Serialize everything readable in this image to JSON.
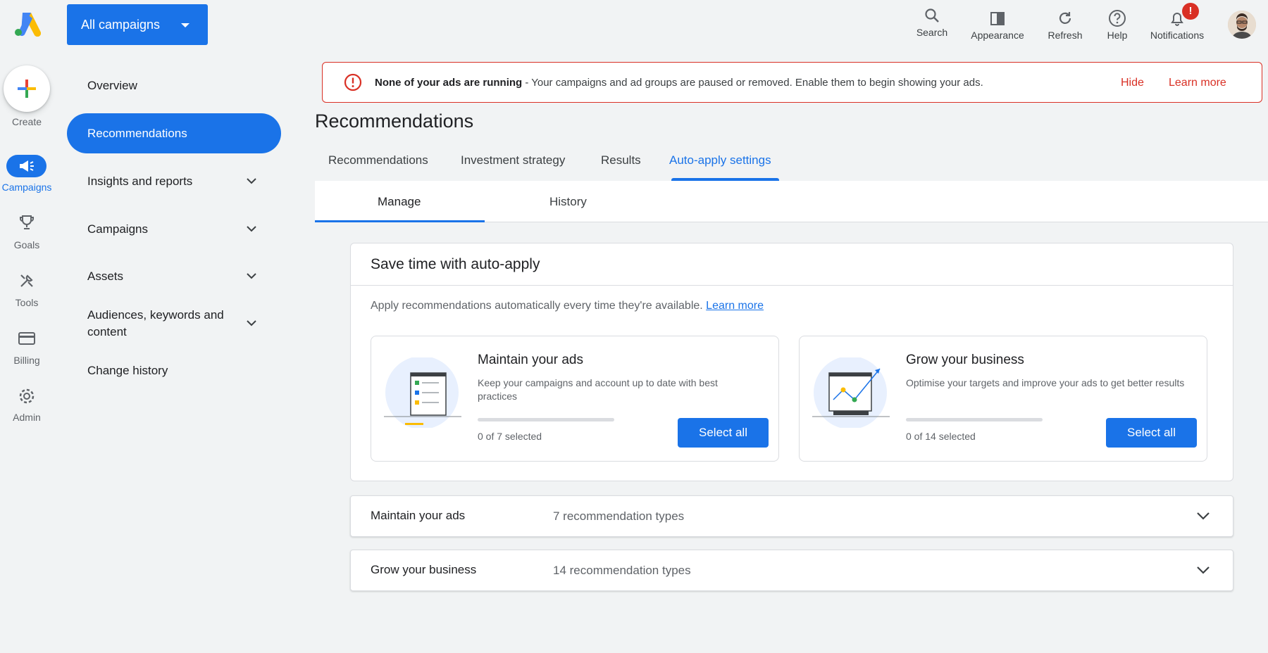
{
  "rail": {
    "create_label": "Create",
    "items": [
      {
        "label": "Campaigns",
        "icon": "campaigns-icon",
        "active": true
      },
      {
        "label": "Goals",
        "icon": "trophy-icon",
        "active": false
      },
      {
        "label": "Tools",
        "icon": "tools-icon",
        "active": false
      },
      {
        "label": "Billing",
        "icon": "credit-card-icon",
        "active": false
      },
      {
        "label": "Admin",
        "icon": "gear-icon",
        "active": false
      }
    ]
  },
  "header": {
    "campaign_selector": "All campaigns",
    "actions": [
      {
        "label": "Search",
        "icon": "search-icon"
      },
      {
        "label": "Appearance",
        "icon": "appearance-icon"
      },
      {
        "label": "Refresh",
        "icon": "refresh-icon"
      },
      {
        "label": "Help",
        "icon": "help-icon"
      },
      {
        "label": "Notifications",
        "icon": "bell-icon"
      }
    ],
    "notification_badge": "!"
  },
  "sidenav": {
    "items": [
      {
        "label": "Overview",
        "expandable": false
      },
      {
        "label": "Recommendations",
        "expandable": false,
        "active": true
      },
      {
        "label": "Insights and reports",
        "expandable": true
      },
      {
        "label": "Campaigns",
        "expandable": true
      },
      {
        "label": "Assets",
        "expandable": true
      },
      {
        "label": "Audiences, keywords and content",
        "expandable": true
      },
      {
        "label": "Change history",
        "expandable": false
      }
    ]
  },
  "alert": {
    "bold": "None of your ads are running",
    "message": " - Your campaigns and ad groups are paused or removed. Enable them to begin showing your ads.",
    "hide": "Hide",
    "learn_more": "Learn more"
  },
  "page": {
    "title": "Recommendations",
    "tabs": [
      "Recommendations",
      "Investment strategy",
      "Results",
      "Auto-apply settings"
    ],
    "active_tab": "Auto-apply settings",
    "subtabs": [
      "Manage",
      "History"
    ],
    "active_subtab": "Manage"
  },
  "card": {
    "title": "Save time with auto-apply",
    "desc": "Apply recommendations automatically every time they're available. ",
    "learn_more": "Learn more",
    "maintain": {
      "title": "Maintain your ads",
      "desc": "Keep your campaigns and account up to date with best practices",
      "count": "0 of 7 selected",
      "progress": 0,
      "button": "Select all"
    },
    "grow": {
      "title": "Grow your business",
      "desc": "Optimise your targets and improve your ads to get better results",
      "count": "0 of 14 selected",
      "progress": 0,
      "button": "Select all"
    }
  },
  "accordions": [
    {
      "title": "Maintain your ads",
      "count": "7 recommendation types"
    },
    {
      "title": "Grow your business",
      "count": "14 recommendation types"
    }
  ],
  "colors": {
    "accent": "#1a73e8",
    "error": "#d93025",
    "background": "#f1f3f4"
  }
}
